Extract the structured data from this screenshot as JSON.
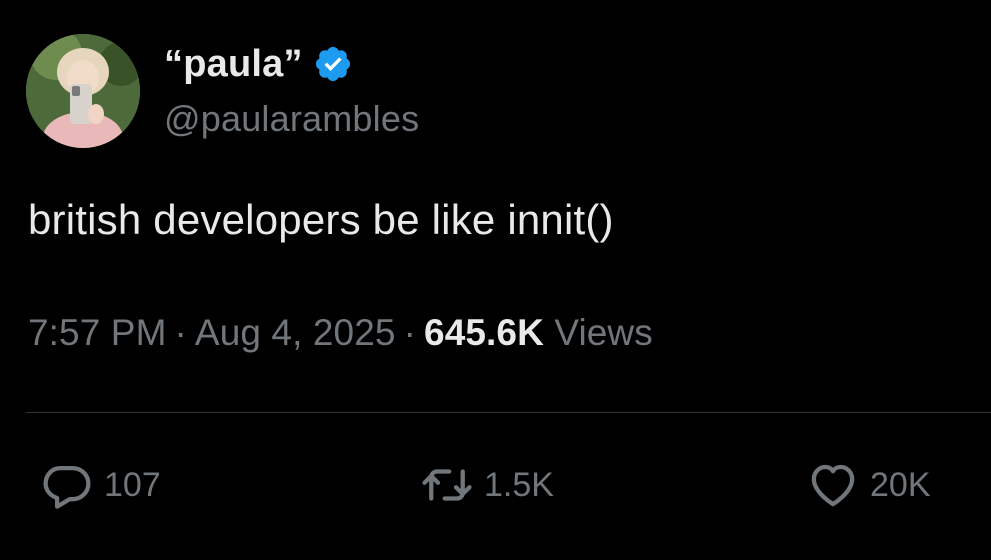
{
  "user": {
    "display_name": "“paula”",
    "handle": "@paularambles",
    "verified_icon": "verified-badge-icon",
    "avatar": "profile-photo"
  },
  "tweet": {
    "text": "british developers be like innit()",
    "time": "7:57 PM",
    "separator": "·",
    "date": "Aug 4, 2025",
    "views_count": "645.6K",
    "views_label": "Views"
  },
  "actions": {
    "reply": {
      "icon": "reply-icon",
      "count": "107"
    },
    "retweet": {
      "icon": "retweet-icon",
      "count": "1.5K"
    },
    "like": {
      "icon": "heart-icon",
      "count": "20K"
    }
  },
  "colors": {
    "background": "#000000",
    "text_primary": "#e7e9ea",
    "text_secondary": "#71767b",
    "divider": "#2f3336",
    "verified": "#1d9bf0"
  }
}
